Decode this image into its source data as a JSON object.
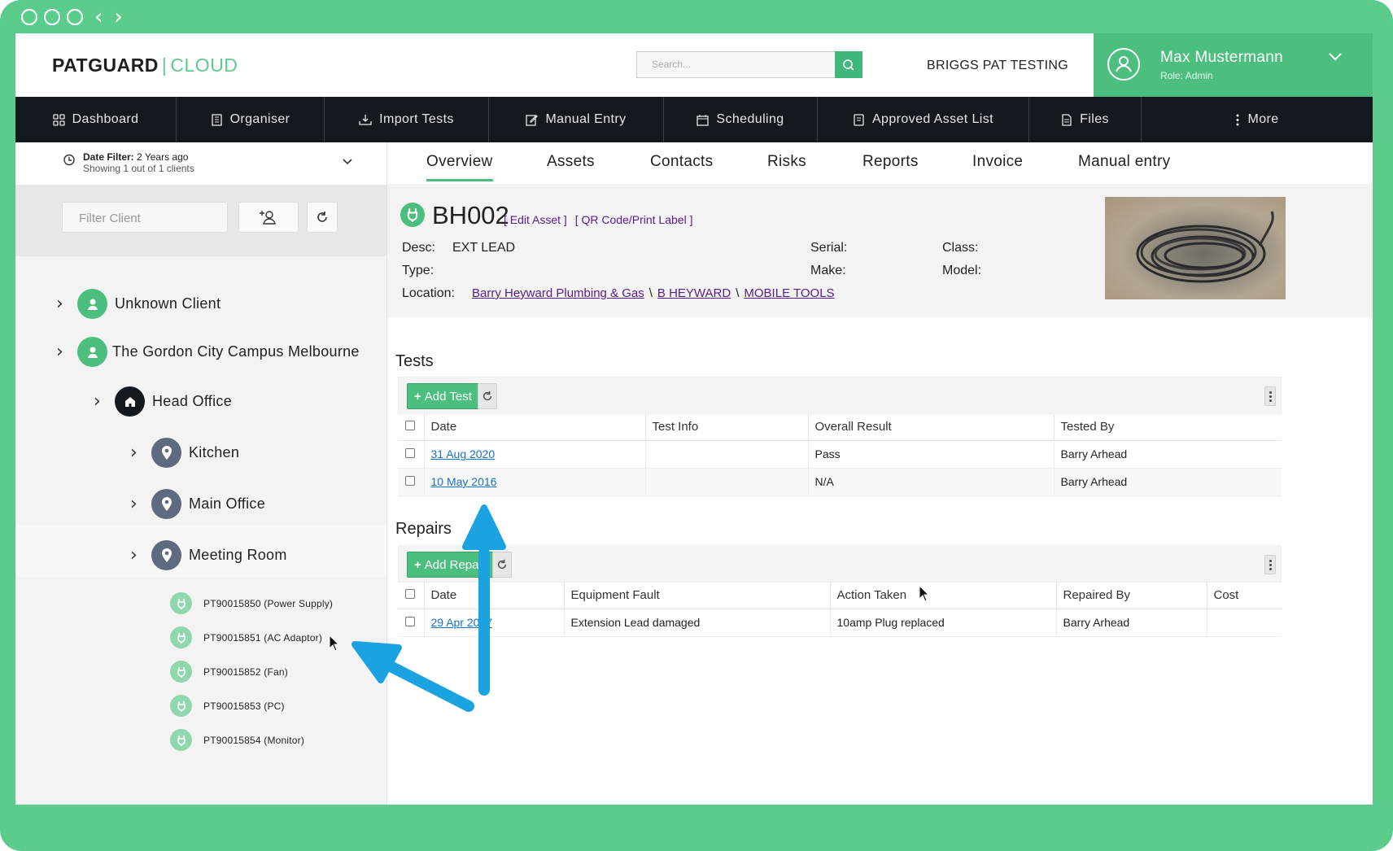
{
  "header": {
    "logo_bold": "PATGUARD",
    "logo_sep": "|",
    "logo_light": "CLOUD",
    "search_placeholder": "Search...",
    "company": "BRIGGS PAT TESTING",
    "user_name": "Max Mustermann",
    "user_role": "Role: Admin"
  },
  "nav": [
    {
      "label": "Dashboard",
      "icon": "grid-icon"
    },
    {
      "label": "Organiser",
      "icon": "building-icon"
    },
    {
      "label": "Import Tests",
      "icon": "import-icon"
    },
    {
      "label": "Manual Entry",
      "icon": "edit-icon"
    },
    {
      "label": "Scheduling",
      "icon": "calendar-icon"
    },
    {
      "label": "Approved Asset List",
      "icon": "list-icon"
    },
    {
      "label": "Files",
      "icon": "file-icon"
    },
    {
      "label": "More",
      "icon": "more-icon"
    }
  ],
  "sidebar": {
    "date_filter_label": "Date Filter:",
    "date_filter_value": "2 Years ago",
    "showing": "Showing 1 out of 1 clients",
    "filter_placeholder": "Filter Client",
    "tree": {
      "client1": "Unknown Client",
      "client2": "The Gordon City Campus Melbourne",
      "site": "Head Office",
      "loc1": "Kitchen",
      "loc2": "Main Office",
      "loc3": "Meeting Room",
      "assets": [
        "PT90015850 (Power Supply)",
        "PT90015851 (AC Adaptor)",
        "PT90015852 (Fan)",
        "PT90015853 (PC)",
        "PT90015854 (Monitor)"
      ]
    }
  },
  "tabs": [
    "Overview",
    "Assets",
    "Contacts",
    "Risks",
    "Reports",
    "Invoice",
    "Manual entry"
  ],
  "asset": {
    "name": "BH002",
    "edit_link": "[ Edit Asset ]",
    "qr_link": "[ QR Code/Print Label ]",
    "desc_label": "Desc:",
    "desc_value": "EXT LEAD",
    "type_label": "Type:",
    "serial_label": "Serial:",
    "make_label": "Make:",
    "class_label": "Class:",
    "model_label": "Model:",
    "location_label": "Location:",
    "location": [
      "Barry Heyward Plumbing & Gas",
      "B HEYWARD",
      "MOBILE TOOLS"
    ],
    "location_sep": "\\"
  },
  "tests": {
    "title": "Tests",
    "add_label": "Add Test",
    "columns": [
      "Date",
      "Test Info",
      "Overall Result",
      "Tested By"
    ],
    "rows": [
      {
        "date": "31 Aug 2020",
        "info": "",
        "result": "Pass",
        "by": "Barry Arhead"
      },
      {
        "date": "10 May 2016",
        "info": "",
        "result": "N/A",
        "by": "Barry Arhead"
      }
    ]
  },
  "repairs": {
    "title": "Repairs",
    "add_label": "Add Repair",
    "columns": [
      "Date",
      "Equipment Fault",
      "Action Taken",
      "Repaired By",
      "Cost"
    ],
    "rows": [
      {
        "date": "29 Apr 2017",
        "fault": "Extension Lead damaged",
        "action": "10amp Plug replaced",
        "by": "Barry Arhead",
        "cost": ""
      }
    ]
  },
  "colors": {
    "accent": "#4cbf7e",
    "frame": "#5ccc8c",
    "nav_bg": "#141920",
    "arrow": "#1aa3e0",
    "link": "#1572c9",
    "asset_link": "#5a1b8c"
  }
}
